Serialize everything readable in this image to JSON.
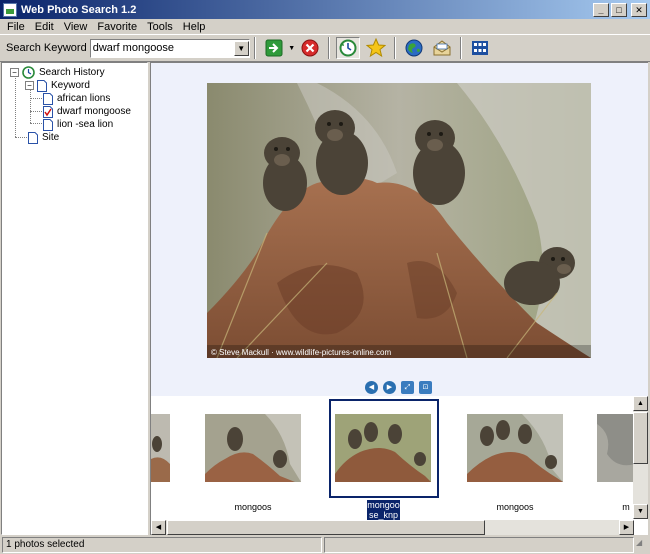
{
  "window": {
    "title": "Web Photo Search 1.2"
  },
  "menu": [
    "File",
    "Edit",
    "View",
    "Favorite",
    "Tools",
    "Help"
  ],
  "toolbar": {
    "keyword_label": "Search Keyword",
    "keyword_value": "dwarf mongoose",
    "buttons": [
      "go-icon",
      "stop-icon",
      "history-icon",
      "favorite-star-icon",
      "web-globe-icon",
      "email-icon",
      "thumbnail-grid-icon"
    ]
  },
  "tree": {
    "root": "Search History",
    "keyword": "Keyword",
    "items": [
      "african lions",
      "dwarf mongoose",
      "lion -sea lion"
    ],
    "site": "Site"
  },
  "viewer": {
    "watermark": "© Steve Mackull · www.wildlife-pictures-online.com"
  },
  "thumbnails": {
    "labels": [
      "mongoos",
      "mongoo se_knp",
      "mongoos",
      "m"
    ]
  },
  "status": {
    "text": "1 photos selected"
  },
  "colors": {
    "accent": "#0a246a",
    "viewer_bg": "#eef1fb"
  }
}
